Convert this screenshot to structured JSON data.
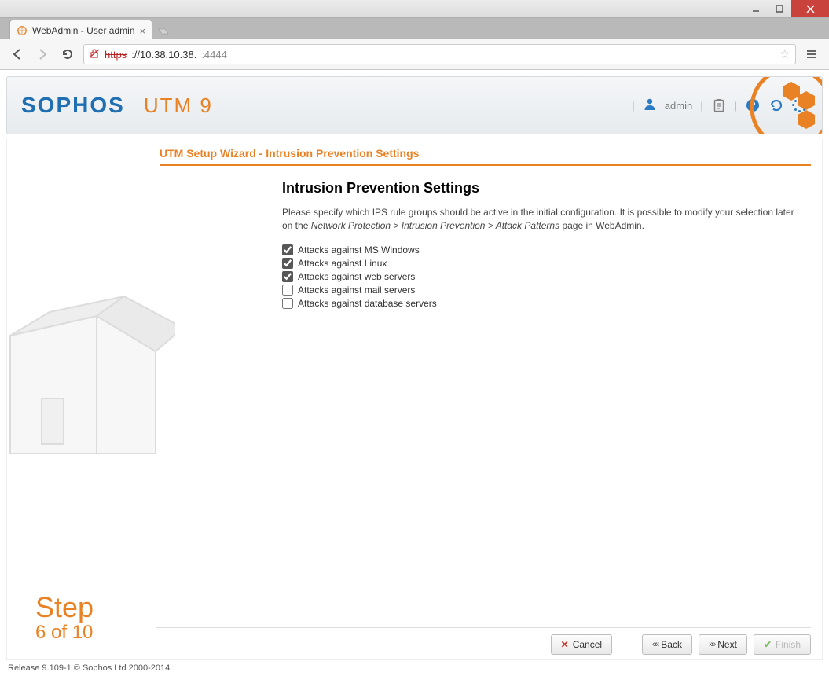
{
  "window": {
    "tab_title": "WebAdmin - User admin",
    "url_scheme": "https",
    "url_host": "://10.38.10.38.",
    "url_port": ":4444"
  },
  "header": {
    "brand": "SOPHOS",
    "product": "UTM 9",
    "user_label": "admin",
    "separator": "|"
  },
  "wizard": {
    "breadcrumb": "UTM Setup Wizard - Intrusion Prevention Settings",
    "title": "Intrusion Prevention Settings",
    "desc_pre": "Please specify which IPS rule groups should be active in the initial configuration. It is possible to modify your selection later on the ",
    "desc_path": "Network Protection > Intrusion Prevention > Attack Patterns",
    "desc_post": " page in WebAdmin.",
    "step_label": "Step",
    "step_number": "6 of 10",
    "options": [
      {
        "label": "Attacks against MS Windows",
        "checked": true
      },
      {
        "label": "Attacks against Linux",
        "checked": true
      },
      {
        "label": "Attacks against web servers",
        "checked": true
      },
      {
        "label": "Attacks against mail servers",
        "checked": false
      },
      {
        "label": "Attacks against database servers",
        "checked": false
      }
    ]
  },
  "buttons": {
    "cancel": "Cancel",
    "back": "Back",
    "next": "Next",
    "finish": "Finish"
  },
  "footer": {
    "release": "Release 9.109-1  © Sophos Ltd 2000-2014"
  }
}
